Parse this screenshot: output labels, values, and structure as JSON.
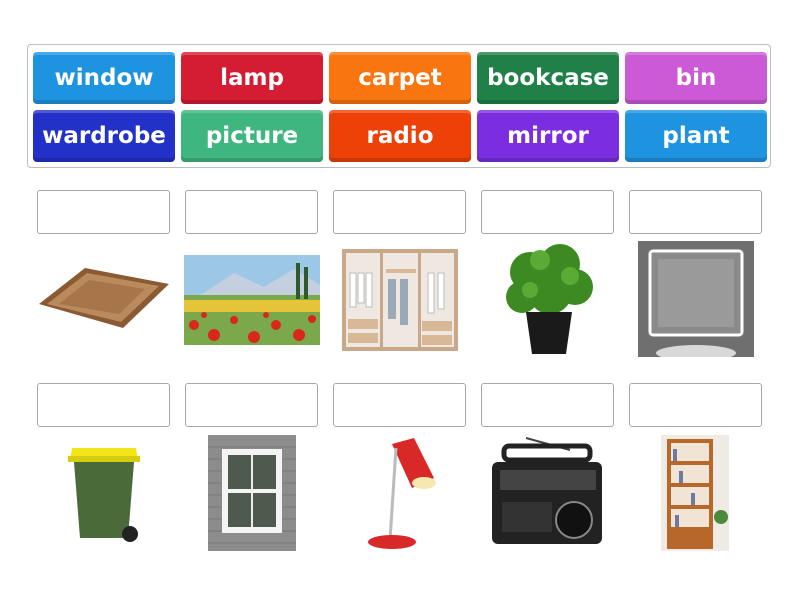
{
  "word_bank": [
    {
      "label": "window",
      "color": "#1e93e0"
    },
    {
      "label": "lamp",
      "color": "#d41c33"
    },
    {
      "label": "carpet",
      "color": "#f97510"
    },
    {
      "label": "bookcase",
      "color": "#208048"
    },
    {
      "label": "bin",
      "color": "#cc5ad6"
    },
    {
      "label": "wardrobe",
      "color": "#2232c8"
    },
    {
      "label": "picture",
      "color": "#3fb57f"
    },
    {
      "label": "radio",
      "color": "#ee4108"
    },
    {
      "label": "mirror",
      "color": "#7b2ee0"
    },
    {
      "label": "plant",
      "color": "#1e93e0"
    }
  ],
  "images": [
    {
      "icon": "carpet-image"
    },
    {
      "icon": "picture-image"
    },
    {
      "icon": "wardrobe-image"
    },
    {
      "icon": "plant-image"
    },
    {
      "icon": "mirror-image"
    },
    {
      "icon": "bin-image"
    },
    {
      "icon": "window-image"
    },
    {
      "icon": "lamp-image"
    },
    {
      "icon": "radio-image"
    },
    {
      "icon": "bookcase-image"
    }
  ]
}
